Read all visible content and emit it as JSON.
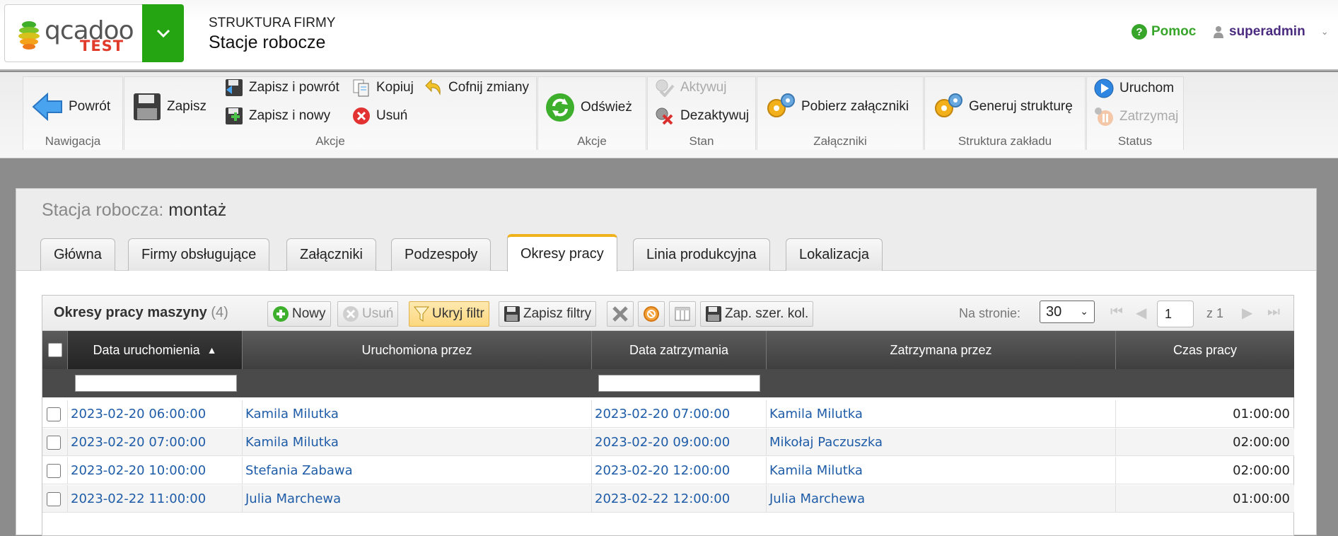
{
  "app": {
    "logo_text": "qcadoo",
    "logo_badge": "TEST",
    "section": "STRUKTURA FIRMY",
    "title": "Stacje robocze",
    "help_label": "Pomoc",
    "user_label": "superadmin"
  },
  "ribbon": {
    "nav_back": "Powrót",
    "nav_group": "Nawigacja",
    "save": "Zapisz",
    "save_back": "Zapisz i powrót",
    "save_new": "Zapisz i nowy",
    "copy": "Kopiuj",
    "delete": "Usuń",
    "undo": "Cofnij zmiany",
    "actions_group": "Akcje",
    "refresh": "Odśwież",
    "actions2_group": "Akcje",
    "activate": "Aktywuj",
    "deactivate": "Dezaktywuj",
    "state_group": "Stan",
    "attachments_get": "Pobierz załączniki",
    "attachments_group": "Załączniki",
    "generate_structure": "Generuj strukturę",
    "structure_group": "Struktura zakładu",
    "start": "Uruchom",
    "stop": "Zatrzymaj",
    "status_group": "Status"
  },
  "record": {
    "label": "Stacja robocza:",
    "name": "montaż"
  },
  "tabs": [
    {
      "label": "Główna"
    },
    {
      "label": "Firmy obsługujące"
    },
    {
      "label": "Załączniki"
    },
    {
      "label": "Podzespoły"
    },
    {
      "label": "Okresy pracy",
      "active": true
    },
    {
      "label": "Linia produkcyjna"
    },
    {
      "label": "Lokalizacja"
    }
  ],
  "grid": {
    "title": "Okresy pracy maszyny",
    "count": "(4)",
    "toolbar": {
      "new": "Nowy",
      "delete": "Usuń",
      "hide_filter": "Ukryj filtr",
      "save_filters": "Zapisz filtry",
      "save_col_widths": "Zap. szer. kol."
    },
    "pager": {
      "per_page_label": "Na stronie:",
      "per_page_value": "30",
      "page": "1",
      "of": "z 1"
    },
    "columns": [
      "Data uruchomienia",
      "Uruchomiona przez",
      "Data zatrzymania",
      "Zatrzymana przez",
      "Czas pracy"
    ],
    "rows": [
      [
        "2023-02-20 06:00:00",
        "Kamila Milutka",
        "2023-02-20 07:00:00",
        "Kamila Milutka",
        "01:00:00"
      ],
      [
        "2023-02-20 07:00:00",
        "Kamila Milutka",
        "2023-02-20 09:00:00",
        "Mikołaj Paczuszka",
        "02:00:00"
      ],
      [
        "2023-02-20 10:00:00",
        "Stefania Zabawa",
        "2023-02-20 12:00:00",
        "Kamila Milutka",
        "02:00:00"
      ],
      [
        "2023-02-22 11:00:00",
        "Julia Marchewa",
        "2023-02-22 12:00:00",
        "Julia Marchewa",
        "01:00:00"
      ]
    ]
  },
  "colors": {
    "brand_green": "#26a512",
    "active_tab": "#f0b21b",
    "link": "#1f5ca8",
    "user": "#4b2b7f"
  }
}
